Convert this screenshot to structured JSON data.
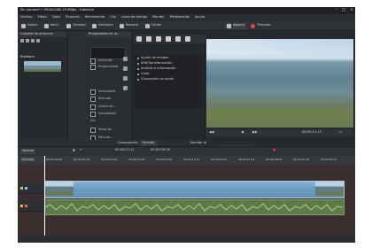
{
  "titlebar": {
    "title": "Sin nombre* / 1920x1080 29.98fps – Kdenlive"
  },
  "menu": [
    "Archivo",
    "Editar",
    "Vista",
    "Proyecto",
    "Herramienta",
    "Clip",
    "Línea de tiempo",
    "Monitor",
    "Preferencias",
    "Ayuda"
  ],
  "toolbar": {
    "new": "Nuevo",
    "open": "Abrir...",
    "save": "Guardar",
    "undo": "Deshacer",
    "redo": "Rehacer",
    "cut": "Cortar",
    "grab": "Agarrar",
    "render": "Procesar"
  },
  "project_bin": {
    "header": "Carpeta de proyecto",
    "clip_name": "Rivedoro"
  },
  "properties": {
    "header": "Propiedades de la...",
    "rows": [
      "Duración",
      "Proporcional",
      "Intensidad",
      "Borrado",
      "Orden de...",
      "Solubilidad",
      "Vía",
      "Rana de...",
      "Para de..."
    ]
  },
  "effects": {
    "items": [
      "Ajuste de imagen",
      "Alfa/Transformación",
      "Análisis e información",
      "Color",
      "Conversión de audio"
    ]
  },
  "bottom_tabs": {
    "composition": "Composición",
    "effects": "Efectos",
    "clip_monitor": "Monitor de clips",
    "project_monitor": "Monitor del proyecto"
  },
  "monitor": {
    "timecode": "00:00:11:15"
  },
  "timeline": {
    "mode": "Normal",
    "timecode_a": "00:00:11:11",
    "timecode_b": "00:00:28:29",
    "tooltip": "Principal",
    "ruler": [
      "00:00:00:00",
      "00:00:03:16",
      "00:00:07:02",
      "00:00:10:18",
      "00:00:14:05",
      "00:00:17:21",
      "00:00:21:07",
      "00:00:24:23",
      "00:00:28:09",
      "00:00:31:25",
      "00:00:35:12",
      "00:00:38:28"
    ]
  }
}
